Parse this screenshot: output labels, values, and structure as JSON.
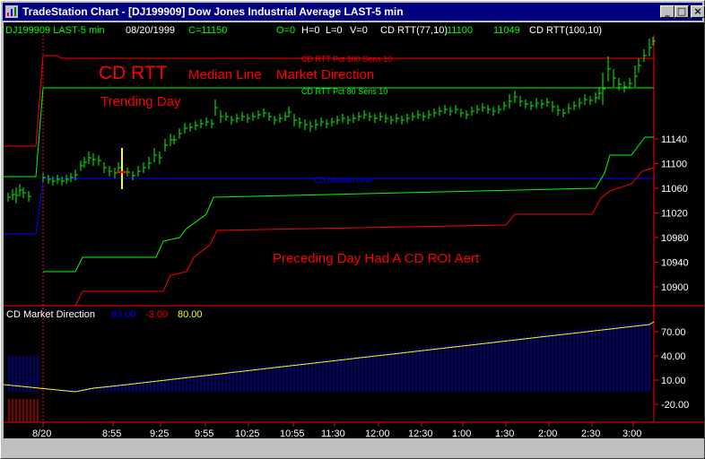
{
  "window": {
    "title": "TradeStation Chart - [DJ199909] Dow Jones Industrial Average LAST-5 min",
    "minimize_label": "_",
    "maximize_label": "□",
    "close_label": "×"
  },
  "header": {
    "symbol": "DJ199909 LAST-5 min",
    "date": "08/20/1999",
    "close": "C=11150",
    "open": "O=0",
    "high": "H=0",
    "low": "L=0",
    "volume": "V=0",
    "study1_name": "CD RTT(77,10)",
    "study1_val1": "11100",
    "study1_val2": "11049",
    "study2_name": "CD RTT(100,10)"
  },
  "annotations": {
    "rtt_title": "CD RTT",
    "median_line_title": "Median Line",
    "market_direction_title": "Market Direction",
    "trending_day": "Trending Day",
    "preceding_day": "Preceding Day Had A CD ROI Aert",
    "pct100_label": "CD RTT Pct 100  Sens 10",
    "pct80_label": "CD RTT Pct 80  Sens 10",
    "median_label": "CD Median Line"
  },
  "price_axis": [
    "11140",
    "11100",
    "11060",
    "11020",
    "10980",
    "10940",
    "10900"
  ],
  "indicator": {
    "name": "CD Market Direction",
    "value1": "83.00",
    "value2": "-3.00",
    "value3": "80.00",
    "axis": [
      "70.00",
      "40.00",
      "10.00",
      "-20.00"
    ]
  },
  "time_axis": [
    "8/20",
    "8:55",
    "9:25",
    "9:55",
    "10:25",
    "10:55",
    "11:30",
    "12:00",
    "12:30",
    "1:00",
    "1:30",
    "2:00",
    "2:30",
    "3:00"
  ],
  "colors": {
    "background": "#000000",
    "green": "#00ff00",
    "red": "#ff0000",
    "blue": "#0000ff",
    "yellow": "#ffff00",
    "title_bar": "#000080",
    "pane_divider": "#ff0000"
  },
  "chart_data": {
    "type": "line",
    "price_pane": {
      "ylim": [
        10880,
        11160
      ],
      "rtt_pct100": [
        11020,
        11135,
        11133,
        11133,
        11133,
        11133,
        11133,
        11133,
        11133,
        11133,
        11133,
        11133,
        11133,
        11133,
        11133,
        11133,
        11133
      ],
      "rtt_pct80": [
        11020,
        11100,
        11100,
        11100,
        11100,
        11100,
        11100,
        11100,
        11100,
        11100,
        11100,
        11100,
        11100,
        11100,
        11100,
        11100,
        11100
      ],
      "median_line": 11004,
      "upper_support": [
        10905,
        10905,
        10925,
        10970,
        10987,
        10987,
        10995,
        10995,
        11025,
        11045
      ],
      "lower_support": [
        10880,
        10890,
        10912,
        10950,
        10970,
        10970,
        10975,
        10975,
        11005,
        11018
      ],
      "price_bars_closing_high": 11150
    },
    "indicator_pane": {
      "ylim": [
        -30,
        80
      ],
      "yellow_line": [
        3,
        5,
        18,
        34,
        52,
        70,
        83
      ],
      "blue_histogram_level": 83
    }
  }
}
